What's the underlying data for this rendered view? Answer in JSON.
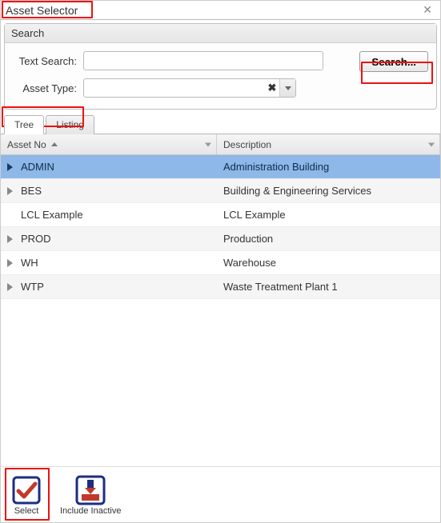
{
  "window": {
    "title": "Asset Selector"
  },
  "search": {
    "panel_label": "Search",
    "text_search_label": "Text Search:",
    "text_search_value": "",
    "asset_type_label": "Asset Type:",
    "asset_type_value": "",
    "search_button": "Search..."
  },
  "tabs": [
    {
      "label": "Tree",
      "active": true
    },
    {
      "label": "Listing",
      "active": false
    }
  ],
  "grid": {
    "columns": {
      "asset_no": "Asset No",
      "description": "Description"
    },
    "sort": {
      "column": "asset_no",
      "dir": "asc"
    },
    "rows": [
      {
        "asset_no": "ADMIN",
        "description": "Administration Building",
        "expandable": true,
        "selected": true
      },
      {
        "asset_no": "BES",
        "description": "Building & Engineering Services",
        "expandable": true,
        "selected": false
      },
      {
        "asset_no": "LCL Example",
        "description": "LCL Example",
        "expandable": false,
        "selected": false
      },
      {
        "asset_no": "PROD",
        "description": "Production",
        "expandable": true,
        "selected": false
      },
      {
        "asset_no": "WH",
        "description": "Warehouse",
        "expandable": true,
        "selected": false
      },
      {
        "asset_no": "WTP",
        "description": "Waste Treatment Plant 1",
        "expandable": true,
        "selected": false
      }
    ]
  },
  "actions": {
    "select": "Select",
    "include_inactive": "Include Inactive"
  }
}
